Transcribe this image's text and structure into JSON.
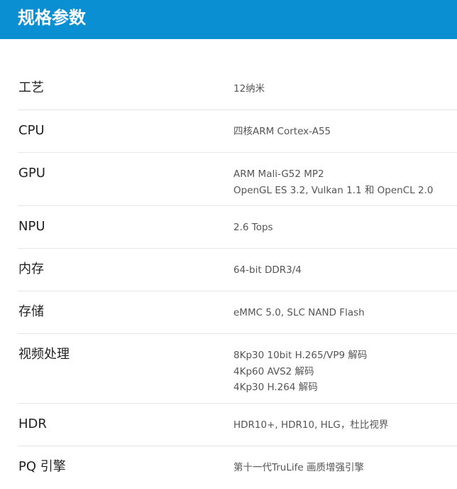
{
  "header": {
    "title": "规格参数"
  },
  "specs": [
    {
      "label": "工艺",
      "values": [
        "12纳米"
      ]
    },
    {
      "label": "CPU",
      "values": [
        "四核ARM Cortex-A55"
      ]
    },
    {
      "label": "GPU",
      "values": [
        "ARM Mali-G52 MP2",
        "OpenGL ES 3.2, Vulkan 1.1 和 OpenCL 2.0"
      ]
    },
    {
      "label": "NPU",
      "values": [
        "2.6 Tops"
      ]
    },
    {
      "label": "内存",
      "values": [
        "64-bit DDR3/4"
      ]
    },
    {
      "label": "存储",
      "values": [
        "eMMC 5.0, SLC NAND Flash"
      ]
    },
    {
      "label": "视频处理",
      "values": [
        "8Kp30 10bit H.265/VP9 解码",
        "4Kp60 AVS2 解码",
        "4Kp30 H.264 解码"
      ]
    },
    {
      "label": "HDR",
      "values": [
        "HDR10+, HDR10, HLG，杜比视界"
      ]
    },
    {
      "label": "PQ 引擎",
      "values": [
        "第十一代TruLife 画质增强引擎"
      ]
    }
  ],
  "colors": {
    "header_bg": "#0a8fd2",
    "header_text": "#ffffff",
    "label_text": "#222222",
    "value_text": "#555555",
    "divider": "#e6e6e6"
  }
}
